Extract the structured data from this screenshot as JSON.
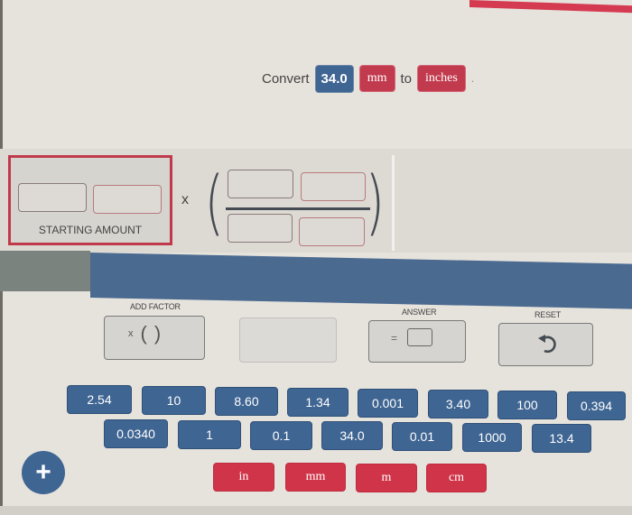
{
  "prompt": {
    "prefix": "Convert",
    "value": "34.0",
    "from_unit": "mm",
    "connector": "to",
    "to_unit": "inches",
    "suffix": "."
  },
  "workspace": {
    "starting_amount_label": "STARTING AMOUNT",
    "times_symbol": "x",
    "open_paren": "(",
    "close_paren": ")"
  },
  "tools": {
    "add_factor_label": "ADD FACTOR",
    "add_factor_glyph_x": "x",
    "add_factor_glyph_open": "(",
    "add_factor_glyph_close": ")",
    "answer_label": "ANSWER",
    "answer_eq": "=",
    "reset_label": "RESET"
  },
  "number_tiles": {
    "row1": [
      "2.54",
      "10",
      "8.60",
      "1.34",
      "0.001",
      "3.40",
      "100",
      "0.394"
    ],
    "row2": [
      "0.0340",
      "1",
      "0.1",
      "34.0",
      "0.01",
      "1000",
      "13.4"
    ]
  },
  "unit_tiles": [
    "in",
    "mm",
    "m",
    "cm"
  ],
  "add_button": "+",
  "colors": {
    "primary_blue": "#3f6592",
    "accent_red": "#d03448",
    "background": "#e6e2dc"
  }
}
